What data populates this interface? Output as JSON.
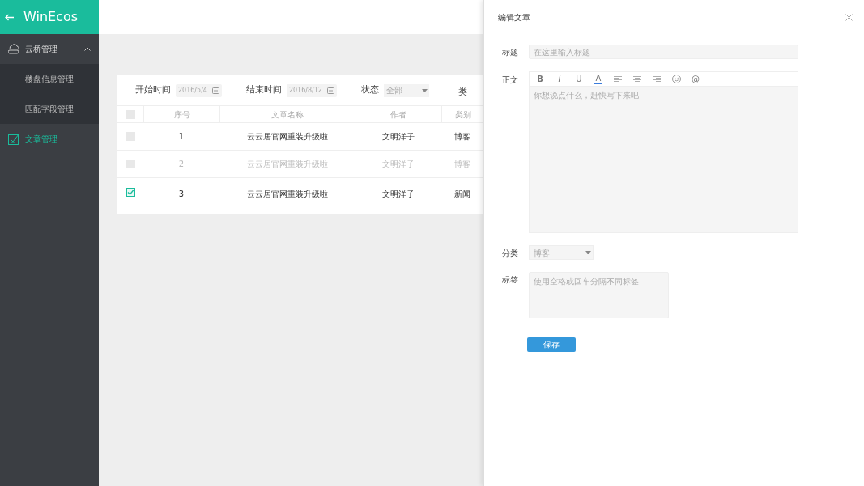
{
  "app": {
    "title": "WinEcos"
  },
  "sidebar": {
    "items": [
      {
        "label": "云桥管理",
        "kind": "group",
        "expanded": true,
        "selected": false,
        "children": [
          {
            "label": "楼盘信息管理",
            "selected": false
          },
          {
            "label": "匹配字段管理",
            "selected": false
          }
        ]
      },
      {
        "label": "文章管理",
        "kind": "item",
        "selected": true
      }
    ]
  },
  "filters": [
    {
      "label": "开始时间",
      "kind": "date",
      "value": "2016/5/4"
    },
    {
      "label": "结束时间",
      "kind": "date",
      "value": "2016/8/12"
    },
    {
      "label": "状态",
      "kind": "select",
      "value": "全部"
    },
    {
      "label": "类",
      "kind": "label"
    }
  ],
  "table": {
    "header_checked": false,
    "columns": [
      "序号",
      "文章名称",
      "作者",
      "类别"
    ],
    "rows": [
      {
        "checked": false,
        "disabled": false,
        "cells": [
          "1",
          "云云居官网重装升级啦",
          "文明洋子",
          "博客"
        ]
      },
      {
        "checked": false,
        "disabled": true,
        "cells": [
          "2",
          "云云居官网重装升级啦",
          "文明洋子",
          "博客"
        ]
      },
      {
        "checked": true,
        "disabled": false,
        "cells": [
          "3",
          "云云居官网重装升级啦",
          "文明洋子",
          "新闻"
        ]
      }
    ]
  },
  "panel": {
    "title": "编辑文章",
    "title_field": {
      "label": "标题",
      "placeholder": "在这里输入标题"
    },
    "body_field": {
      "label": "正文",
      "placeholder": "你想说点什么，赶快写下来吧",
      "toolbar": [
        {
          "kind": "bold",
          "text": "B"
        },
        {
          "kind": "italic",
          "text": "I"
        },
        {
          "kind": "underline",
          "text": "U"
        },
        {
          "kind": "color",
          "text": "A"
        },
        {
          "kind": "align-left"
        },
        {
          "kind": "align-center"
        },
        {
          "kind": "align-right"
        },
        {
          "kind": "emoji"
        },
        {
          "kind": "at",
          "text": "@"
        }
      ]
    },
    "category_field": {
      "label": "分类",
      "value": "博客"
    },
    "tags_field": {
      "label": "标签",
      "placeholder": "使用空格或回车分隔不同标签"
    },
    "save_button": "保存"
  }
}
